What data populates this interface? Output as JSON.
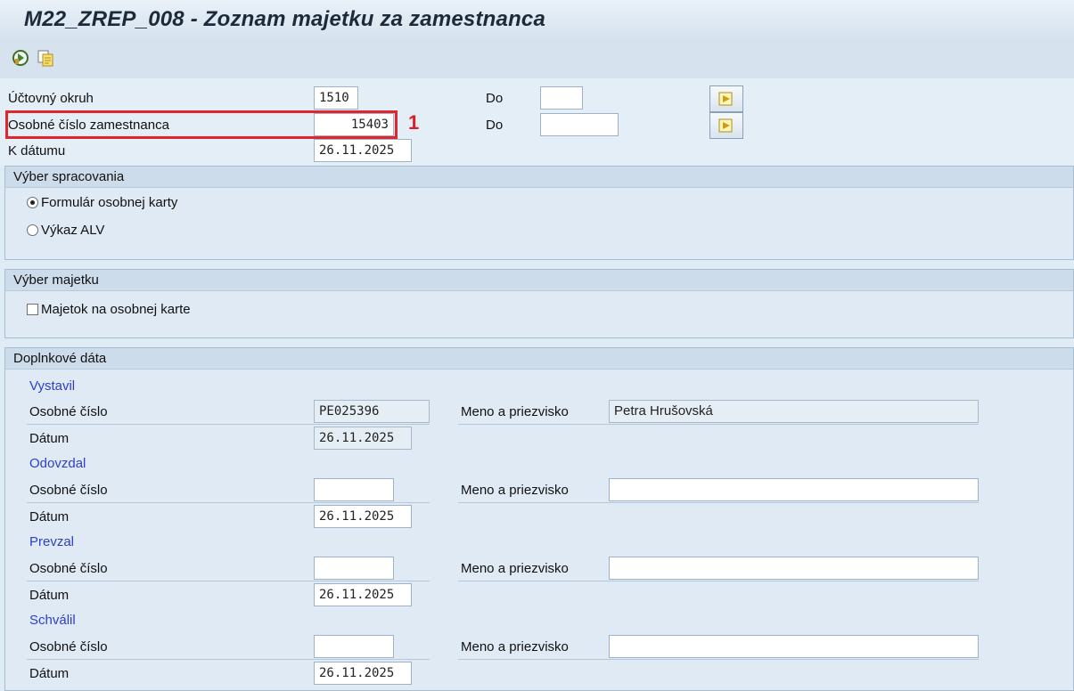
{
  "title": "M22_ZREP_008  - Zoznam majetku za zamestnanca",
  "toolbar": {
    "icons": [
      "execute-icon",
      "copy-variant-icon"
    ]
  },
  "selection": {
    "company_code_label": "Účtovný okruh",
    "company_code_value": "1510",
    "company_code_to_label": "Do",
    "company_code_to_value": "",
    "employee_label": "Osobné číslo zamestnanca",
    "employee_value": "15403",
    "employee_to_label": "Do",
    "employee_to_value": "",
    "date_label": "K dátumu",
    "date_value": "26.11.2025"
  },
  "annotation": {
    "marker": "1",
    "color": "#e0262c"
  },
  "processing": {
    "header": "Výber spracovania",
    "options": [
      {
        "label": "Formulár osobnej karty",
        "selected": true
      },
      {
        "label": "Výkaz ALV",
        "selected": false
      }
    ]
  },
  "assets": {
    "header": "Výber majetku",
    "checkbox_label": "Majetok na osobnej karte",
    "checked": false
  },
  "extra": {
    "header": "Doplnkové dáta",
    "groups": [
      {
        "title": "Vystavil",
        "pernr_label": "Osobné číslo",
        "pernr_value": "PE025396",
        "name_label": "Meno a priezvisko",
        "name_value": "Petra Hrušovská",
        "date_label": "Dátum",
        "date_value": "26.11.2025"
      },
      {
        "title": "Odovzdal",
        "pernr_label": "Osobné číslo",
        "pernr_value": "",
        "name_label": "Meno a priezvisko",
        "name_value": "",
        "date_label": "Dátum",
        "date_value": "26.11.2025"
      },
      {
        "title": "Prevzal",
        "pernr_label": "Osobné číslo",
        "pernr_value": "",
        "name_label": "Meno a priezvisko",
        "name_value": "",
        "date_label": "Dátum",
        "date_value": "26.11.2025"
      },
      {
        "title": "Schválil",
        "pernr_label": "Osobné číslo",
        "pernr_value": "",
        "name_label": "Meno a priezvisko",
        "name_value": "",
        "date_label": "Dátum",
        "date_value": "26.11.2025"
      }
    ]
  }
}
